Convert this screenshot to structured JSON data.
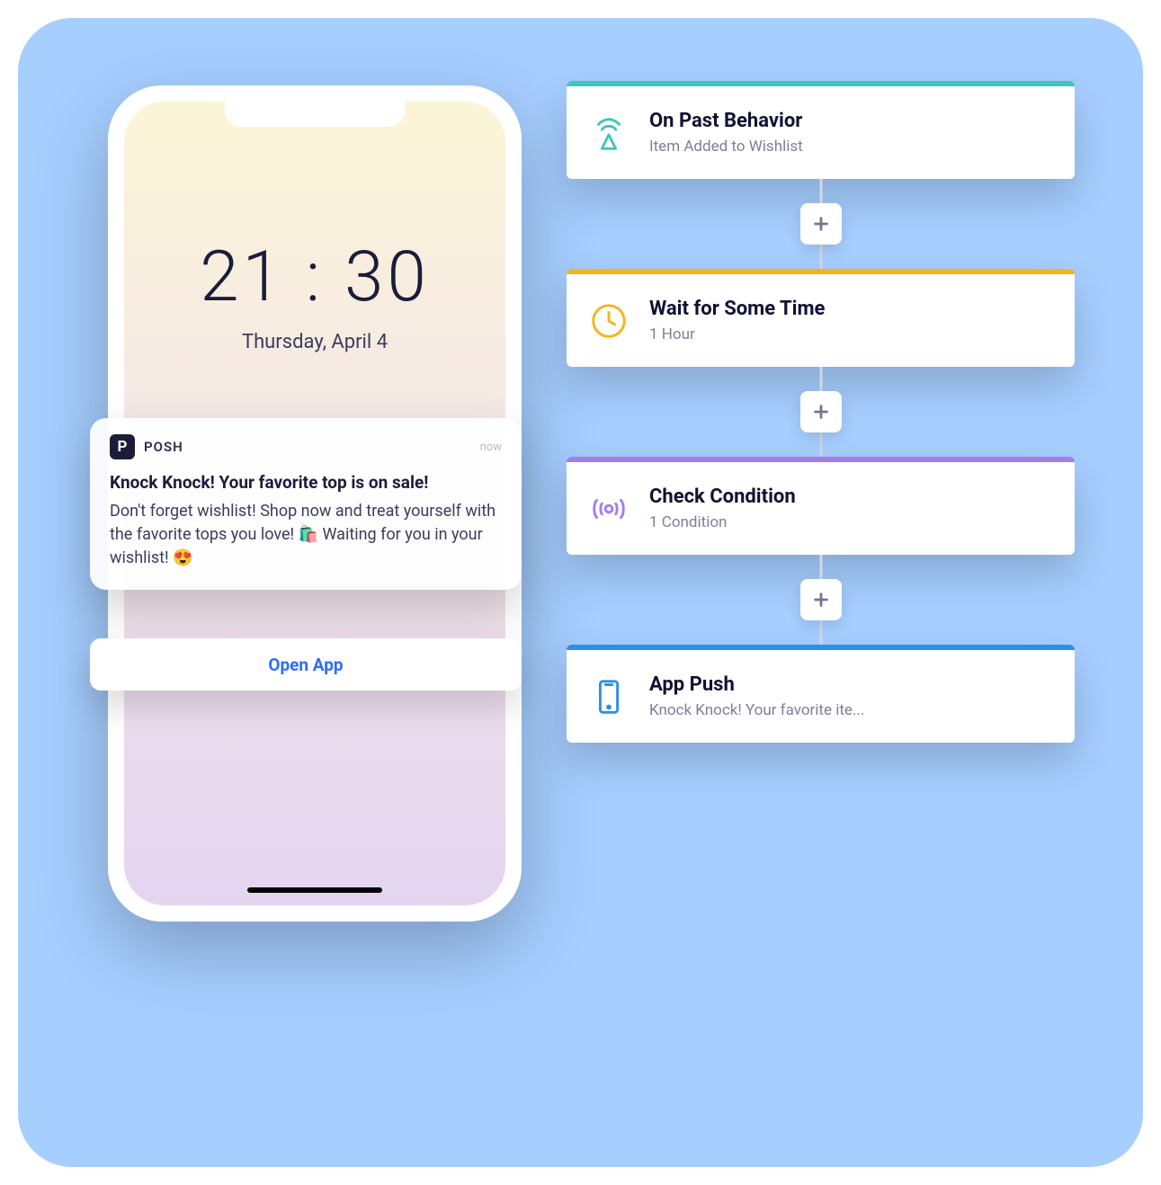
{
  "phone": {
    "time": "21 : 30",
    "date": "Thursday, April 4"
  },
  "notification": {
    "app_letter": "P",
    "app_name": "POSH",
    "timestamp": "now",
    "title": "Knock Knock! Your favorite top is on sale!",
    "body": "Don't forget wishlist! Shop now and treat yourself with the favorite tops you love! 🛍️ Waiting for you in your wishlist! 😍",
    "action_label": "Open App"
  },
  "flow": {
    "nodes": [
      {
        "title": "On Past Behavior",
        "subtitle": "Item Added to Wishlist",
        "accent": "teal",
        "icon": "antenna"
      },
      {
        "title": "Wait for Some Time",
        "subtitle": "1 Hour",
        "accent": "yellow",
        "icon": "clock"
      },
      {
        "title": "Check Condition",
        "subtitle": "1 Condition",
        "accent": "purple",
        "icon": "signal"
      },
      {
        "title": "App Push",
        "subtitle": "Knock Knock! Your favorite ite...",
        "accent": "blue",
        "icon": "phone"
      }
    ],
    "add_label": "+"
  },
  "colors": {
    "teal": "#3ec7ba",
    "yellow": "#f3b51b",
    "purple": "#a57cf0",
    "blue": "#2d8fe8"
  }
}
